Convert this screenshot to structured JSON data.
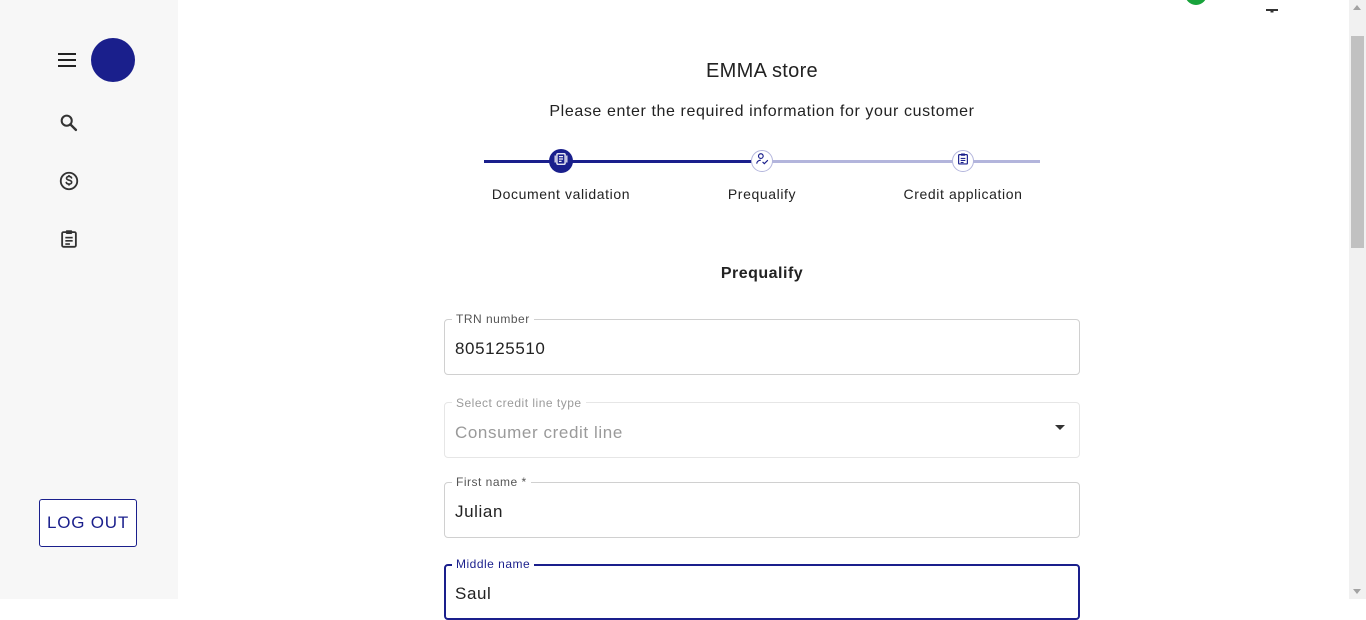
{
  "sidebar": {
    "nav": [
      {
        "icon": "search-icon"
      },
      {
        "icon": "dollar-circle-icon"
      },
      {
        "icon": "clipboard-icon"
      }
    ],
    "logout_label": "LOG OUT"
  },
  "header": {
    "store_name": "EMMA store",
    "subtitle": "Please enter the required information for your customer"
  },
  "stepper": {
    "steps": [
      {
        "label": "Document validation",
        "icon": "document-icon",
        "state": "completed"
      },
      {
        "label": "Prequalify",
        "icon": "person-check-icon",
        "state": "active"
      },
      {
        "label": "Credit application",
        "icon": "clipboard-icon",
        "state": "pending"
      }
    ]
  },
  "form": {
    "section_title": "Prequalify",
    "trn": {
      "label": "TRN number",
      "value": "805125510"
    },
    "credit_line": {
      "label": "Select credit line type",
      "value": "Consumer credit line"
    },
    "first_name": {
      "label": "First name *",
      "value": "Julian"
    },
    "middle_name": {
      "label": "Middle name",
      "value": "Saul"
    }
  },
  "colors": {
    "primary": "#1a1f8c",
    "track_inactive": "#b3b5dc",
    "status_green": "#18a33b"
  }
}
